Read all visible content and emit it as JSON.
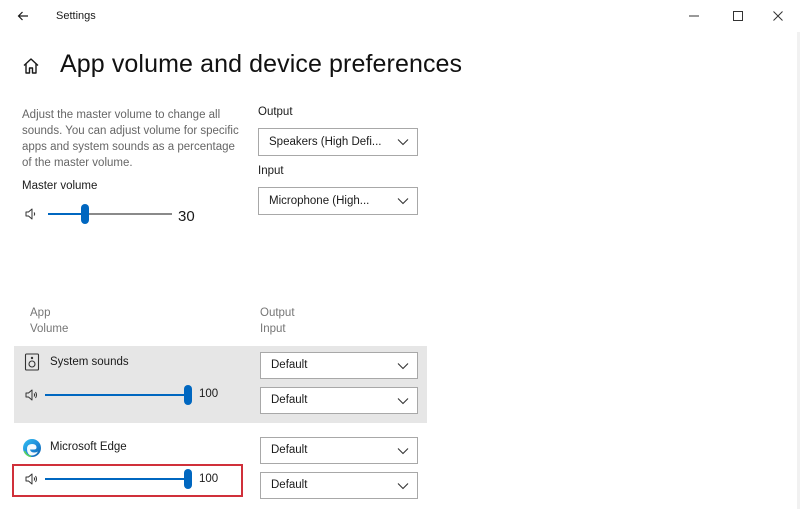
{
  "window": {
    "title": "Settings"
  },
  "page": {
    "title": "App volume and device preferences"
  },
  "master": {
    "description": "Adjust the master volume to change all sounds. You can adjust volume for specific apps and system sounds as a percentage of the master volume.",
    "label": "Master volume",
    "value": 30
  },
  "output": {
    "label": "Output",
    "selected": "Speakers (High Defi..."
  },
  "input": {
    "label": "Input",
    "selected": "Microphone (High..."
  },
  "columns": {
    "app": "App",
    "volume": "Volume",
    "output": "Output",
    "input": "Input"
  },
  "apps": [
    {
      "name": "System sounds",
      "volume": 100,
      "output": "Default",
      "input": "Default"
    },
    {
      "name": "Microsoft Edge",
      "volume": 100,
      "output": "Default",
      "input": "Default"
    }
  ],
  "colors": {
    "accent": "#0067c0",
    "highlight_box": "#d0303a",
    "panel_bg": "#e6e6e6"
  },
  "icons": {
    "back": "back-arrow-icon",
    "home": "home-icon",
    "speaker": "speaker-icon",
    "system_sounds": "system-sounds-icon",
    "edge": "microsoft-edge-icon",
    "chevron": "chevron-down-icon"
  }
}
